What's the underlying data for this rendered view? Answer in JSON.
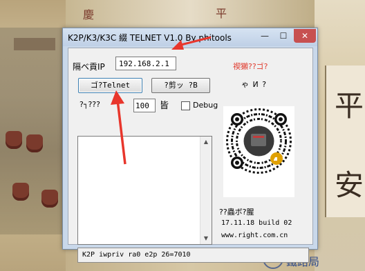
{
  "window": {
    "title": "K2P/K3/K3C 綴  TELNET V1.0 By phitools",
    "min_glyph": "—",
    "max_glyph": "☐",
    "close_glyph": "✕"
  },
  "router_ip": {
    "label": "隔ベ貢IP",
    "value": "192.168.2.1"
  },
  "buttons": {
    "open_telnet": "ゴ?Telnet",
    "secondary": "?剪ッ  ?B"
  },
  "delay": {
    "label": "?┐???",
    "value": "100",
    "unit": "皆"
  },
  "debug": {
    "label": "Debug",
    "checked": false
  },
  "sidebar": {
    "red_note": "禊獺??ゴ?",
    "sub_note": "ゃ   И  ?",
    "author_label": "??蟲ボ?腥",
    "version": "17.11.18 build 02",
    "website": "www.right.com.cn"
  },
  "status": {
    "text": "K2P iwpriv ra0 e2p 26=7010"
  },
  "colors": {
    "accent_red": "#e03b2e",
    "title_bg": "#c9d8ea",
    "dialog_bg": "#f0f0f0"
  }
}
